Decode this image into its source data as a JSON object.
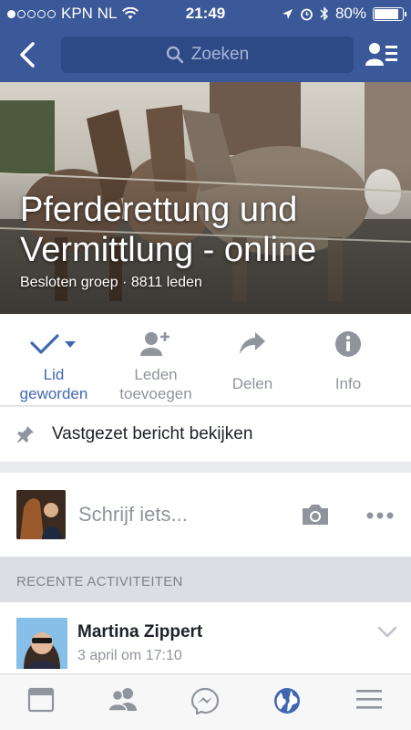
{
  "status_bar": {
    "carrier": "KPN NL",
    "time": "21:49",
    "battery": "80%",
    "battery_level": 0.8
  },
  "nav": {
    "search_placeholder": "Zoeken"
  },
  "group": {
    "title": "Pferderettung und Vermittlung - online",
    "subtitle": "Besloten groep · 8811 leden"
  },
  "actions": [
    {
      "label_line1": "Lid",
      "label_line2": "geworden",
      "icon": "checkmark-icon"
    },
    {
      "label_line1": "Leden",
      "label_line2": "toevoegen",
      "icon": "add-person-icon"
    },
    {
      "label_line1": "Delen",
      "label_line2": "",
      "icon": "share-icon"
    },
    {
      "label_line1": "Info",
      "label_line2": "",
      "icon": "info-icon"
    }
  ],
  "pinned": {
    "label": "Vastgezet bericht bekijken"
  },
  "composer": {
    "prompt": "Schrijf iets..."
  },
  "section": {
    "recent_header": "RECENTE ACTIVITEITEN"
  },
  "post": {
    "author": "Martina Zippert",
    "time": "3 april om 17:10"
  },
  "tabs": [
    "news-feed-icon",
    "friends-icon",
    "messenger-icon",
    "globe-icon",
    "menu-icon"
  ],
  "colors": {
    "brand": "#3b5998",
    "accent": "#4267b2",
    "muted": "#90949c"
  }
}
